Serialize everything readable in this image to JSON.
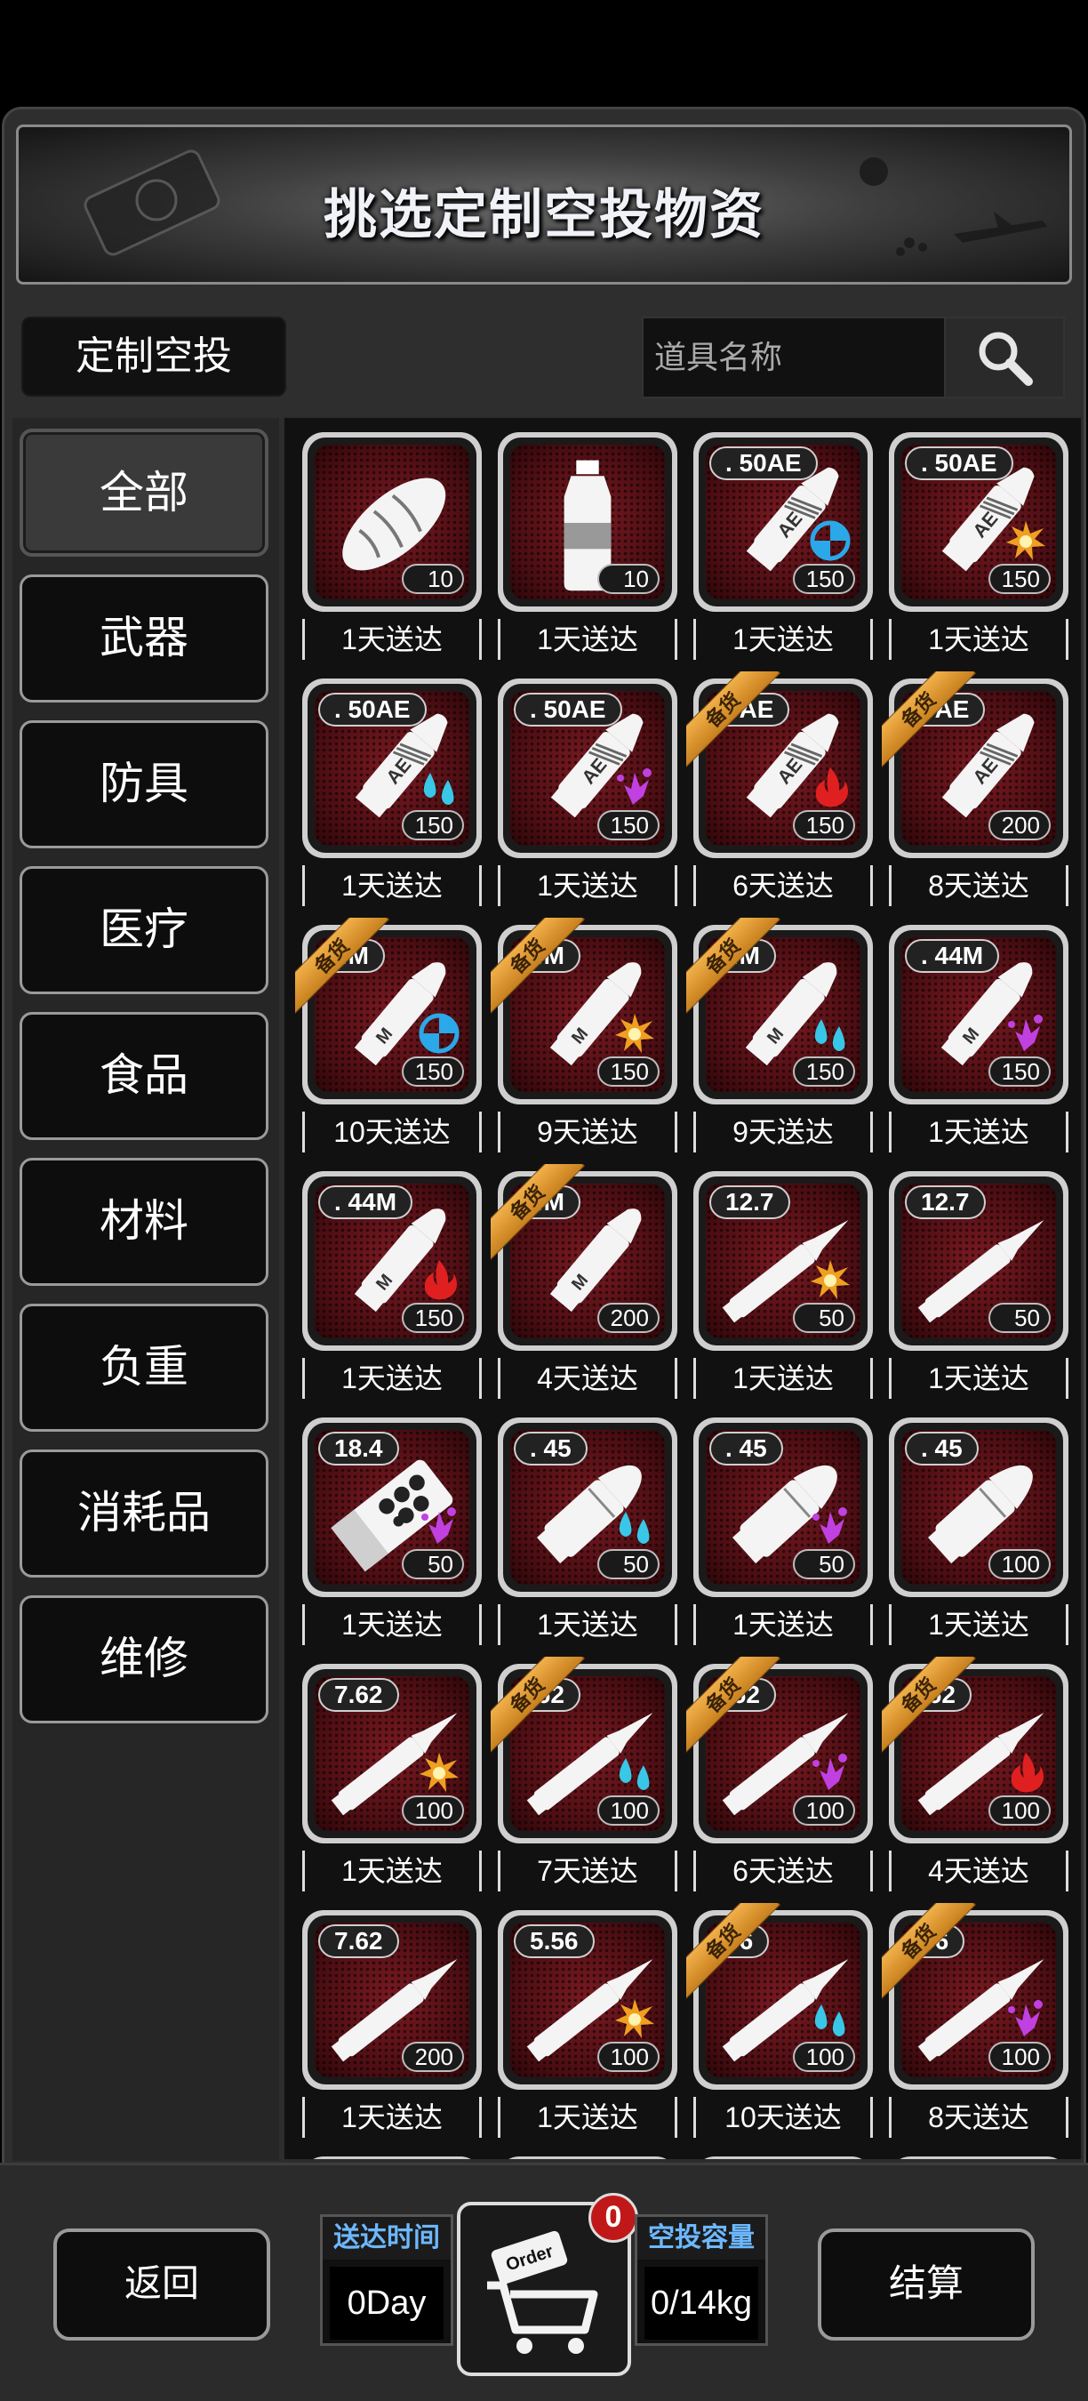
{
  "banner": {
    "title": "挑选定制空投物资"
  },
  "tab": {
    "label": "定制空投"
  },
  "search": {
    "placeholder": "道具名称"
  },
  "categories": [
    {
      "label": "全部",
      "active": true
    },
    {
      "label": "武器"
    },
    {
      "label": "防具"
    },
    {
      "label": "医疗"
    },
    {
      "label": "食品"
    },
    {
      "label": "材料"
    },
    {
      "label": "负重"
    },
    {
      "label": "消耗品"
    },
    {
      "label": "维修"
    }
  ],
  "items": [
    {
      "caliber": "",
      "qty": "10",
      "delivery": "1天送达",
      "icon": "bread-icon",
      "effect": "",
      "stock_tag": ""
    },
    {
      "caliber": "",
      "qty": "10",
      "delivery": "1天送达",
      "icon": "water-bottle-icon",
      "effect": "",
      "stock_tag": ""
    },
    {
      "caliber": ". 50AE",
      "qty": "150",
      "delivery": "1天送达",
      "icon": "cartridge-ae-icon",
      "effect": "armor-pierce-icon",
      "stock_tag": ""
    },
    {
      "caliber": ". 50AE",
      "qty": "150",
      "delivery": "1天送达",
      "icon": "cartridge-ae-icon",
      "effect": "explosive-icon",
      "stock_tag": ""
    },
    {
      "caliber": ". 50AE",
      "qty": "150",
      "delivery": "1天送达",
      "icon": "cartridge-ae-icon",
      "effect": "water-icon",
      "stock_tag": ""
    },
    {
      "caliber": ". 50AE",
      "qty": "150",
      "delivery": "1天送达",
      "icon": "cartridge-ae-icon",
      "effect": "toxic-icon",
      "stock_tag": ""
    },
    {
      "caliber": "0AE",
      "qty": "150",
      "delivery": "6天送达",
      "icon": "cartridge-ae-icon",
      "effect": "fire-icon",
      "stock_tag": "备货"
    },
    {
      "caliber": "0AE",
      "qty": "200",
      "delivery": "8天送达",
      "icon": "cartridge-ae-icon",
      "effect": "",
      "stock_tag": "备货"
    },
    {
      "caliber": "4M",
      "qty": "150",
      "delivery": "10天送达",
      "icon": "cartridge-m-icon",
      "effect": "armor-pierce-icon",
      "stock_tag": "备货"
    },
    {
      "caliber": "4M",
      "qty": "150",
      "delivery": "9天送达",
      "icon": "cartridge-m-icon",
      "effect": "explosive-icon",
      "stock_tag": "备货"
    },
    {
      "caliber": "4M",
      "qty": "150",
      "delivery": "9天送达",
      "icon": "cartridge-m-icon",
      "effect": "water-icon",
      "stock_tag": "备货"
    },
    {
      "caliber": ". 44M",
      "qty": "150",
      "delivery": "1天送达",
      "icon": "cartridge-m-icon",
      "effect": "toxic-icon",
      "stock_tag": ""
    },
    {
      "caliber": ". 44M",
      "qty": "150",
      "delivery": "1天送达",
      "icon": "cartridge-m-icon",
      "effect": "fire-icon",
      "stock_tag": ""
    },
    {
      "caliber": "4M",
      "qty": "200",
      "delivery": "4天送达",
      "icon": "cartridge-m-icon",
      "effect": "",
      "stock_tag": "备货"
    },
    {
      "caliber": "12.7",
      "qty": "50",
      "delivery": "1天送达",
      "icon": "rifle-round-icon",
      "effect": "explosive-icon",
      "stock_tag": ""
    },
    {
      "caliber": "12.7",
      "qty": "50",
      "delivery": "1天送达",
      "icon": "rifle-round-icon",
      "effect": "",
      "stock_tag": ""
    },
    {
      "caliber": "18.4",
      "qty": "50",
      "delivery": "1天送达",
      "icon": "shotgun-shell-icon",
      "effect": "toxic-icon",
      "stock_tag": ""
    },
    {
      "caliber": ". 45",
      "qty": "50",
      "delivery": "1天送达",
      "icon": "pistol-round-icon",
      "effect": "water-icon",
      "stock_tag": ""
    },
    {
      "caliber": ". 45",
      "qty": "50",
      "delivery": "1天送达",
      "icon": "pistol-round-icon",
      "effect": "toxic-icon",
      "stock_tag": ""
    },
    {
      "caliber": ". 45",
      "qty": "100",
      "delivery": "1天送达",
      "icon": "pistol-round-icon",
      "effect": "",
      "stock_tag": ""
    },
    {
      "caliber": "7.62",
      "qty": "100",
      "delivery": "1天送达",
      "icon": "rifle-round-icon",
      "effect": "explosive-icon",
      "stock_tag": ""
    },
    {
      "caliber": ".62",
      "qty": "100",
      "delivery": "7天送达",
      "icon": "rifle-round-icon",
      "effect": "water-icon",
      "stock_tag": "备货"
    },
    {
      "caliber": ".62",
      "qty": "100",
      "delivery": "6天送达",
      "icon": "rifle-round-icon",
      "effect": "toxic-icon",
      "stock_tag": "备货"
    },
    {
      "caliber": ".62",
      "qty": "100",
      "delivery": "4天送达",
      "icon": "rifle-round-icon",
      "effect": "fire-icon",
      "stock_tag": "备货"
    },
    {
      "caliber": "7.62",
      "qty": "200",
      "delivery": "1天送达",
      "icon": "rifle-round-icon",
      "effect": "",
      "stock_tag": ""
    },
    {
      "caliber": "5.56",
      "qty": "100",
      "delivery": "1天送达",
      "icon": "rifle-round-icon",
      "effect": "explosive-icon",
      "stock_tag": ""
    },
    {
      "caliber": "56",
      "qty": "100",
      "delivery": "10天送达",
      "icon": "rifle-round-icon",
      "effect": "water-icon",
      "stock_tag": "备货"
    },
    {
      "caliber": "56",
      "qty": "100",
      "delivery": "8天送达",
      "icon": "rifle-round-icon",
      "effect": "toxic-icon",
      "stock_tag": "备货"
    }
  ],
  "footer": {
    "back_label": "返回",
    "checkout_label": "结算",
    "delivery_time_label": "送达时间",
    "delivery_time_value": "0Day",
    "capacity_label": "空投容量",
    "capacity_value": "0/14kg",
    "cart_text": "Order",
    "cart_count": "0"
  },
  "colors": {
    "effect_armor_pierce": "#2aa8e8",
    "effect_explosive": "#f0a020",
    "effect_water": "#39c7e8",
    "effect_toxic": "#c040e0",
    "effect_fire": "#e02020",
    "stock_ribbon": "#e0a040",
    "label_blue": "#6cb8ff"
  }
}
